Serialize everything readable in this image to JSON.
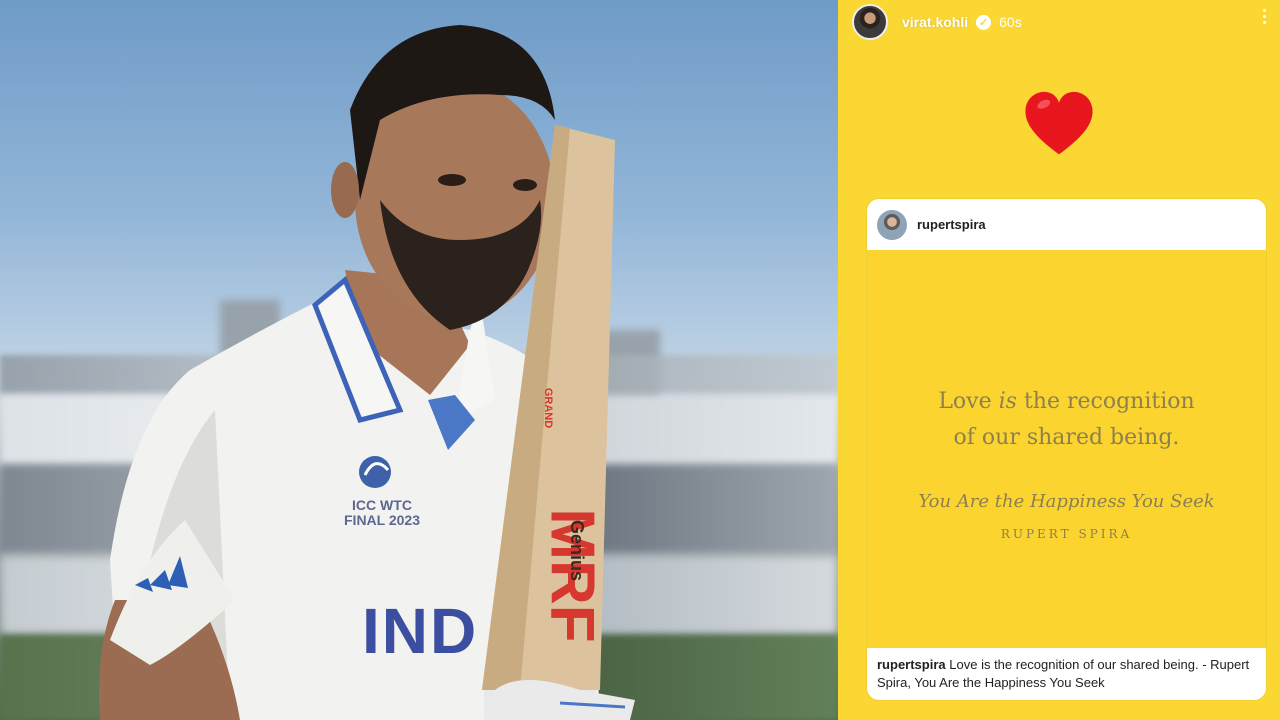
{
  "story": {
    "username": "virat.kohli",
    "verified_mark": "✓",
    "time": "60s",
    "more_icon": "more-vertical-icon",
    "reaction_emoji": "heart",
    "reaction_color": "#e8161e",
    "background_color": "#fbd733"
  },
  "shared_post": {
    "username": "rupertspira",
    "quote_part1": "Love",
    "quote_emphasis": "is",
    "quote_part2": "the recognition",
    "quote_line2": "of our shared being.",
    "book_title": "You Are the Happiness You Seek",
    "author": "RUPERT SPIRA",
    "caption_user": "rupertspira",
    "caption_text": "Love is the recognition of our shared being. - Rupert Spira, You Are the Happiness You Seek"
  },
  "photo": {
    "jersey_logo_line1": "ICC WTC",
    "jersey_logo_line2": "FINAL 2023",
    "jersey_team": "IND",
    "bat_brand": "MRF",
    "bat_model": "Genius",
    "bat_grand": "GRAND"
  }
}
